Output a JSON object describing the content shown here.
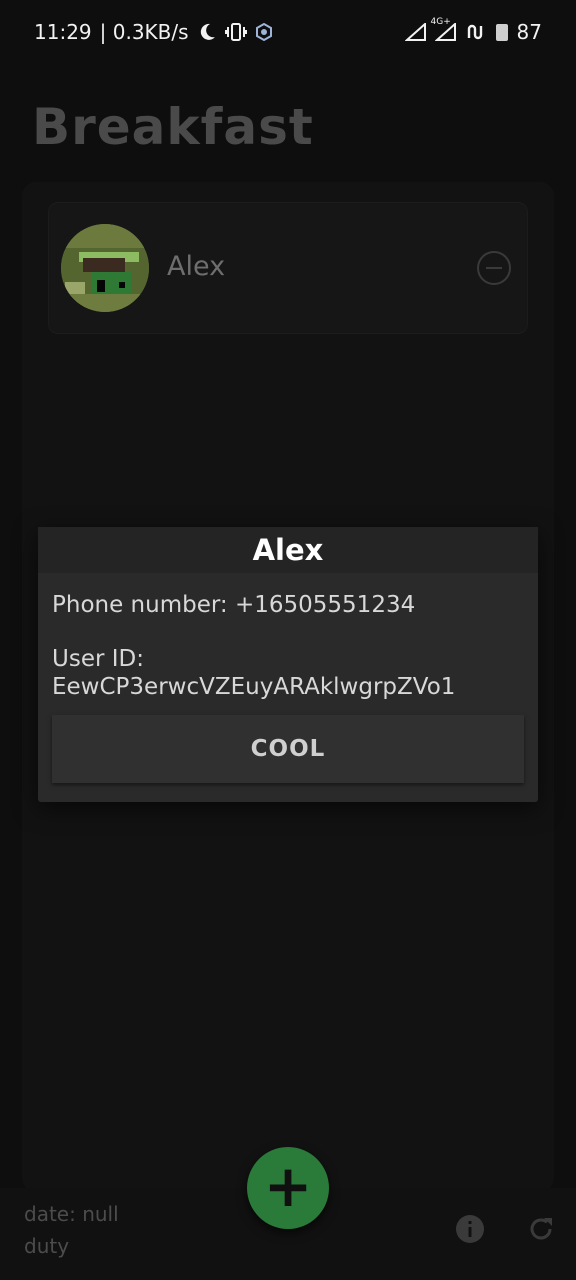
{
  "status_bar": {
    "time": "11:29",
    "net_speed": "| 0.3KB/s",
    "network_label": "4G+",
    "battery": "87"
  },
  "app": {
    "title": "Breakfast"
  },
  "participants": [
    {
      "name": "Alex"
    }
  ],
  "dialog": {
    "title": "Alex",
    "phone_line": "Phone number: +16505551234",
    "user_id_label": "User ID:",
    "user_id_value": "EewCP3erwcVZEuyARAklwgrpZVo1",
    "button_label": "COOL"
  },
  "footer": {
    "date_line": "date: null",
    "duty_line": "duty",
    "fab_symbol": "+"
  },
  "colors": {
    "fab": "#2a7a3a",
    "background": "#0e0e0e"
  }
}
